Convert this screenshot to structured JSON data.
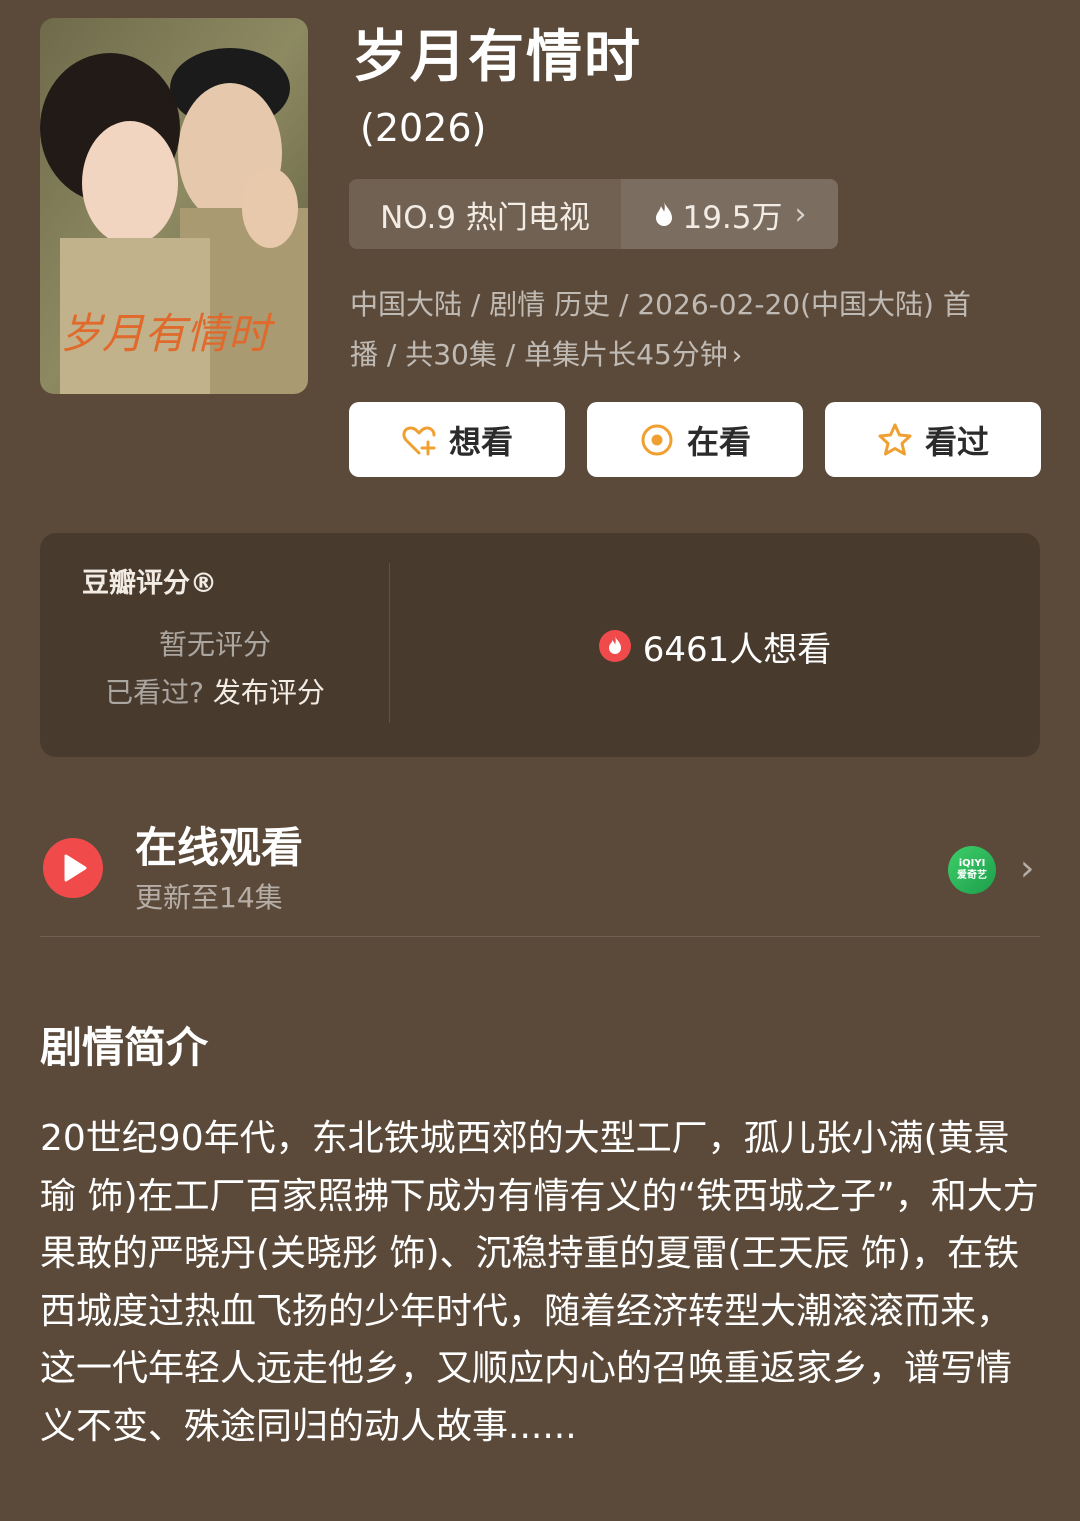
{
  "header": {
    "title": "岁月有情时",
    "year": "(2026)",
    "poster_title_art": "岁月有情时",
    "rank_label": "NO.9 热门电视",
    "heat": "19.5万",
    "meta_line1": "中国大陆 / 剧情 历史 / 2026-02-20(中国大陆) 首",
    "meta_line2": "播 / 共30集 / 单集片长45分钟"
  },
  "actions": {
    "want": "想看",
    "watching": "在看",
    "watched": "看过"
  },
  "rating": {
    "title": "豆瓣评分®",
    "no_rating": "暂无评分",
    "prompt_q": "已看过?",
    "prompt_link": "发布评分",
    "want_count": "6461人想看"
  },
  "online": {
    "title": "在线观看",
    "subtitle": "更新至14集",
    "platform_top": "iQIYI",
    "platform_bottom": "爱奇艺"
  },
  "synopsis": {
    "title": "剧情简介",
    "body": "20世纪90年代，东北铁城西郊的大型工厂，孤儿张小满(黄景瑜 饰)在工厂百家照拂下成为有情有义的“铁西城之子”，和大方果敢的严晓丹(关晓彤 饰)、沉稳持重的夏雷(王天辰 饰)，在铁西城度过热血飞扬的少年时代，随着经济转型大潮滚滚而来，这一代年轻人远走他乡，又顺应内心的召唤重返家乡，谱写情义不变、殊途同归的动人故事......"
  },
  "colors": {
    "background": "#5b4a3a",
    "accent_orange": "#f0a030",
    "accent_red": "#f04a4a"
  }
}
